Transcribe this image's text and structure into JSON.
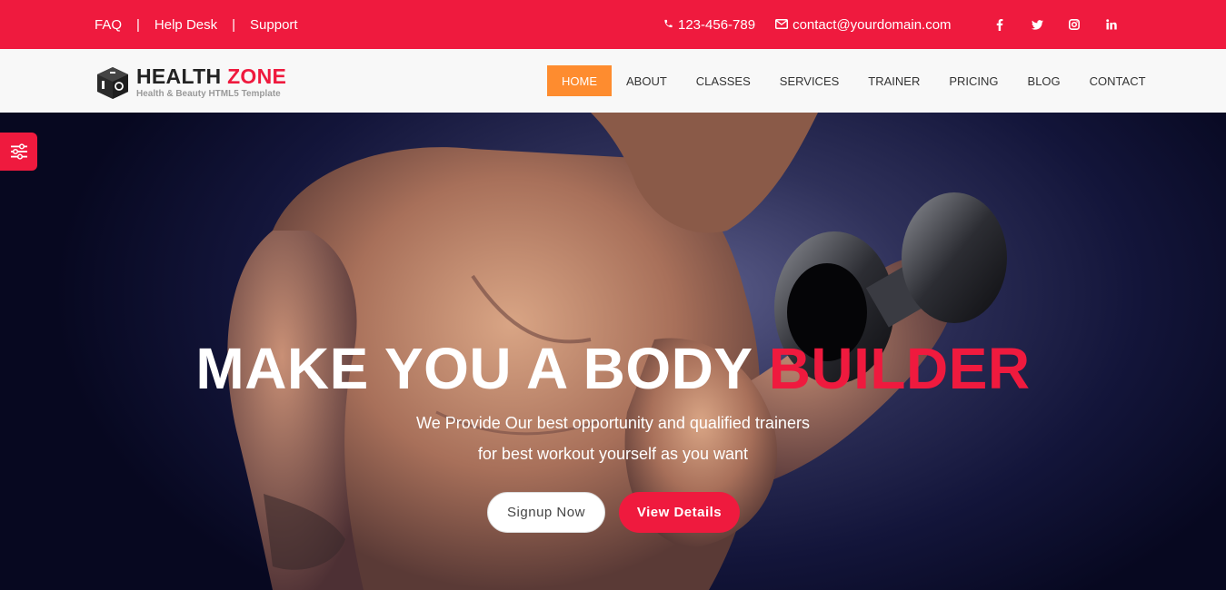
{
  "topbar": {
    "links": [
      "FAQ",
      "Help Desk",
      "Support"
    ],
    "separator": "|",
    "phone": "123-456-789",
    "email": "contact@yourdomain.com",
    "social": [
      "f",
      "t",
      "ig",
      "in"
    ]
  },
  "brand": {
    "title_a": "HEALTH",
    "title_b": "ZONE",
    "subtitle": "Health & Beauty HTML5 Template"
  },
  "nav": {
    "items": [
      "HOME",
      "ABOUT",
      "CLASSES",
      "SERVICES",
      "TRAINER",
      "PRICING",
      "BLOG",
      "CONTACT"
    ],
    "active": "HOME"
  },
  "hero": {
    "headline_a": "MAKE YOU A BODY",
    "headline_b": "BUILDER",
    "line1": "We Provide Our best opportunity and qualified trainers",
    "line2": "for best workout yourself as you want",
    "signup": "Signup Now",
    "details": "View Details"
  },
  "colors": {
    "primary": "#ef1a3e",
    "active_nav": "#fe8c2f"
  }
}
